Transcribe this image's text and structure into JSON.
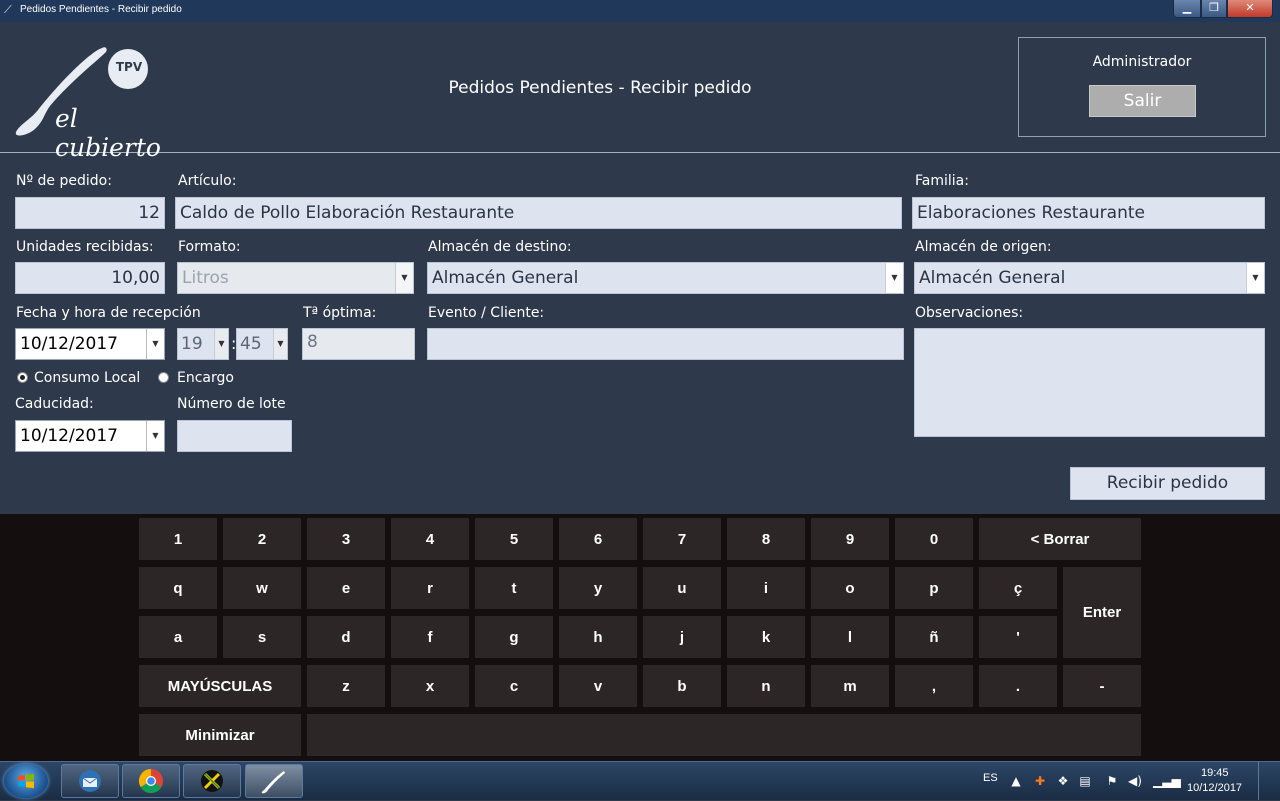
{
  "window": {
    "title": "Pedidos Pendientes - Recibir pedido"
  },
  "header": {
    "logo_badge": "TPV",
    "logo_text": "el cubierto",
    "page_title": "Pedidos Pendientes - Recibir pedido",
    "user": "Administrador",
    "logout_label": "Salir"
  },
  "form": {
    "order_no": {
      "label": "Nº de pedido:",
      "value": "12"
    },
    "article": {
      "label": "Artículo:",
      "value": "Caldo de Pollo Elaboración Restaurante"
    },
    "family": {
      "label": "Familia:",
      "value": "Elaboraciones Restaurante"
    },
    "units": {
      "label": "Unidades recibidas:",
      "value": "10,00"
    },
    "format": {
      "label": "Formato:",
      "value": "Litros"
    },
    "dest_store": {
      "label": "Almacén de destino:",
      "value": "Almacén General"
    },
    "origin_store": {
      "label": "Almacén de origen:",
      "value": "Almacén General"
    },
    "reception": {
      "label": "Fecha y hora  de recepción",
      "date": "10/12/2017",
      "hour": "19",
      "minute": "45",
      "separator": ":"
    },
    "temperature": {
      "label": "Tª óptima:",
      "value": "8"
    },
    "event": {
      "label": "Evento / Cliente:",
      "value": ""
    },
    "observations": {
      "label": "Observaciones:",
      "value": ""
    },
    "consumption": {
      "local_label": "Consumo Local",
      "order_label": "Encargo",
      "selected": "local"
    },
    "expiry": {
      "label": "Caducidad:",
      "date": "10/12/2017"
    },
    "lot": {
      "label": "Número de lote",
      "value": ""
    },
    "submit_label": "Recibir pedido"
  },
  "keyboard": {
    "row1": [
      "1",
      "2",
      "3",
      "4",
      "5",
      "6",
      "7",
      "8",
      "9",
      "0"
    ],
    "backspace": "< Borrar",
    "row2": [
      "q",
      "w",
      "e",
      "r",
      "t",
      "y",
      "u",
      "i",
      "o",
      "p",
      "ç"
    ],
    "enter": "Enter",
    "row3": [
      "a",
      "s",
      "d",
      "f",
      "g",
      "h",
      "j",
      "k",
      "l",
      "ñ",
      "'"
    ],
    "shift": "MAYÚSCULAS",
    "row4": [
      "z",
      "x",
      "c",
      "v",
      "b",
      "n",
      "m",
      ",",
      ".",
      "-"
    ],
    "minimize": "Minimizar"
  },
  "taskbar": {
    "language": "ES",
    "time": "19:45",
    "date": "10/12/2017"
  },
  "colors": {
    "app_bg": "#2e3a4c",
    "field_bg": "#dde4f0",
    "keyboard_bg": "#140e0e",
    "key_bg": "#2c2626"
  }
}
